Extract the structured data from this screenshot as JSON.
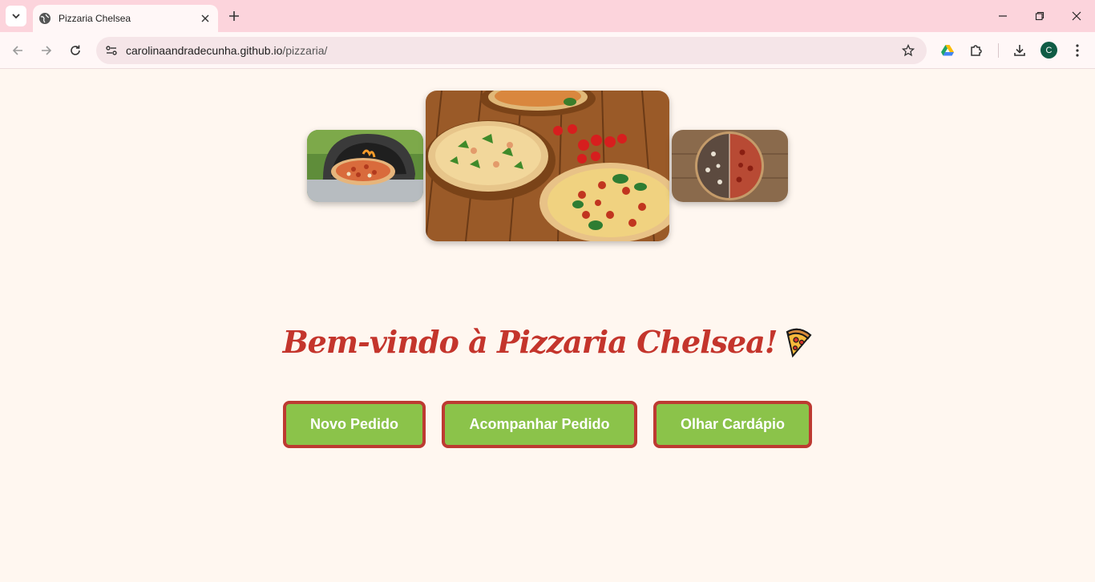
{
  "browser": {
    "tab_title": "Pizzaria Chelsea",
    "url_host": "carolinaandradecunha.github.io",
    "url_path": "/pizzaria/",
    "profile_initial": "C",
    "icons": [
      "tab-search-chevron-icon",
      "globe-icon",
      "close-icon",
      "plus-icon",
      "minimize-icon",
      "restore-icon",
      "window-close-icon",
      "back-arrow-icon",
      "forward-arrow-icon",
      "reload-icon",
      "site-info-icon",
      "star-icon",
      "google-drive-icon",
      "extensions-puzzle-icon",
      "download-icon",
      "kebab-menu-icon"
    ]
  },
  "page": {
    "carousel": {
      "images": [
        {
          "name": "pizza-in-oven",
          "position": "left"
        },
        {
          "name": "pizzas-on-wooden-table",
          "position": "center"
        },
        {
          "name": "half-and-half-pizza",
          "position": "right"
        }
      ]
    },
    "welcome": "Bem-vindo à Pizzaria Chelsea!",
    "welcome_icon": "pizza-slice-icon",
    "buttons": {
      "novo_pedido": "Novo Pedido",
      "acompanhar_pedido": "Acompanhar Pedido",
      "olhar_cardapio": "Olhar Cardápio"
    }
  },
  "colors": {
    "page_background": "#fff7f0",
    "heading": "#c4352c",
    "button_fill": "#8bc34a",
    "button_border": "#bd3a32",
    "tabbar": "#fcd4dc"
  }
}
